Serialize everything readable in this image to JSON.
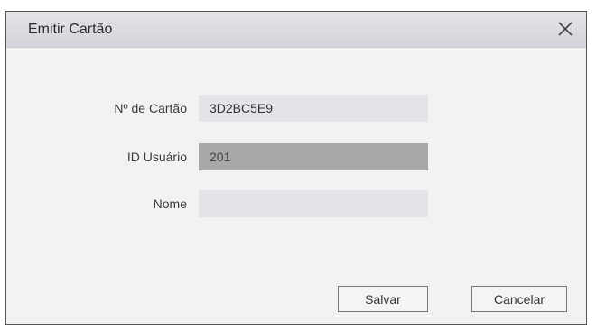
{
  "dialog": {
    "title": "Emitir Cartão",
    "close_icon": "close-icon"
  },
  "form": {
    "card_number": {
      "label": "Nº de Cartão",
      "value": "3D2BC5E9"
    },
    "user_id": {
      "label": "ID Usuário",
      "value": "201",
      "disabled": true
    },
    "name": {
      "label": "Nome",
      "value": ""
    }
  },
  "buttons": {
    "save_label": "Salvar",
    "cancel_label": "Cancelar"
  }
}
